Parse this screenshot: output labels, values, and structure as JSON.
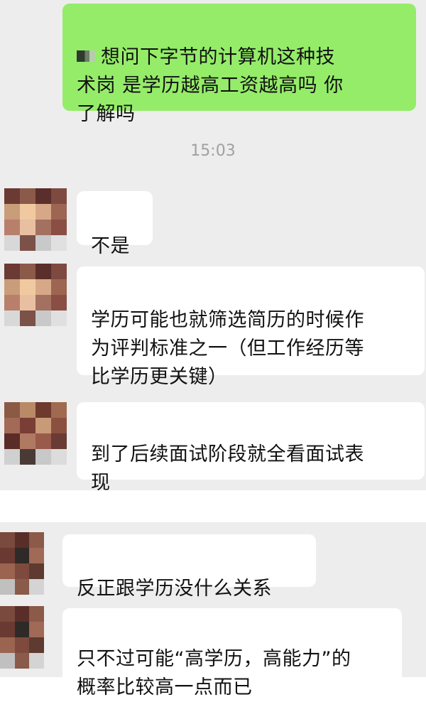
{
  "chat": {
    "timestamp": "15:03",
    "my_message": "想问下字节的计算机这种技\n术岗 是学历越高工资越高吗 你\n了解吗",
    "redacted_icon": "redacted-name-icon",
    "replies": [
      {
        "text": "不是",
        "avatar": "pixelated-avatar"
      },
      {
        "text": "学历可能也就筛选简历的时候作\n为评判标准之一（但工作经历等\n比学历更关键）",
        "avatar": "pixelated-avatar"
      },
      {
        "text": "到了后续面试阶段就全看面试表\n现",
        "avatar": "pixelated-avatar"
      },
      {
        "text": "反正跟学历没什么关系",
        "avatar": "pixelated-avatar"
      },
      {
        "text": "只不过可能“高学历，高能力”的\n概率比较高一点而已",
        "avatar": "pixelated-avatar"
      }
    ]
  },
  "colors": {
    "background": "#ededed",
    "my_bubble": "#95ec69",
    "their_bubble": "#ffffff",
    "timestamp": "#a0a0a0"
  }
}
